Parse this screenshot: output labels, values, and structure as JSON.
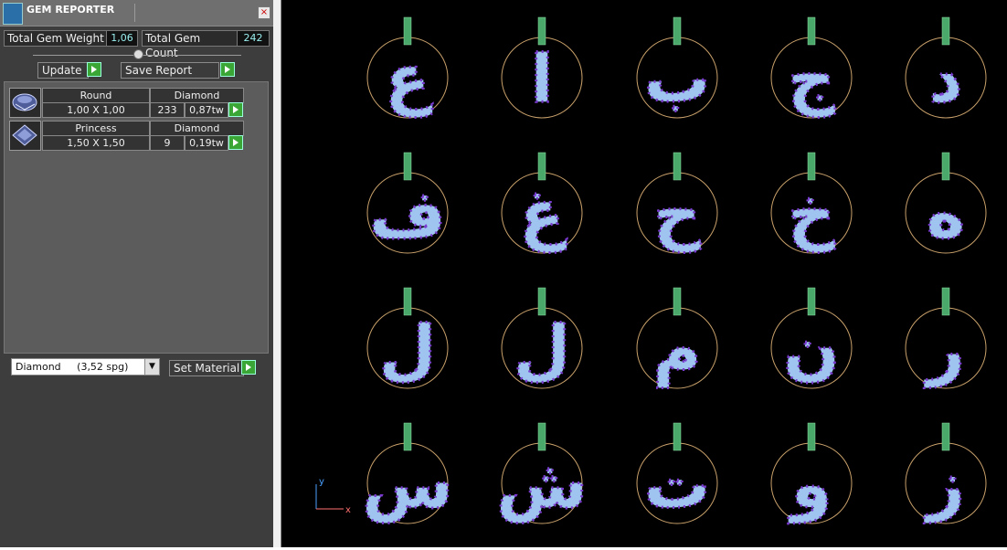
{
  "panel": {
    "title": "GEM REPORTER",
    "close_glyph": "×",
    "total_weight_label": "Total Gem Weight",
    "total_weight_value": "1,06",
    "total_count_label": "Total Gem Count",
    "total_count_value": "242",
    "update_label": "Update",
    "save_report_label": "Save Report",
    "gems": [
      {
        "icon": "round-gem-icon",
        "shape": "Round",
        "material": "Diamond",
        "size": "1,00 X 1,00",
        "count": "233",
        "weight": "0,87tw"
      },
      {
        "icon": "princess-gem-icon",
        "shape": "Princess",
        "material": "Diamond",
        "size": "1,50 X 1,50",
        "count": "9",
        "weight": "0,19tw"
      }
    ],
    "material_select": "Diamond     (3,52 spg)",
    "set_material_label": "Set Material"
  },
  "viewport": {
    "axis_y": "y",
    "axis_x": "x",
    "colors": {
      "background": "#000000",
      "ring": "#c8a06a",
      "beads": "#9fc4ef",
      "bead_dots": "#7a3bd1",
      "bail": "#4aa86a",
      "princess": "#22d046"
    },
    "pendants": [
      {
        "glyph": "ع"
      },
      {
        "glyph": "ا"
      },
      {
        "glyph": "ب"
      },
      {
        "glyph": "ج"
      },
      {
        "glyph": "د"
      },
      {
        "glyph": "ف"
      },
      {
        "glyph": "غ"
      },
      {
        "glyph": "ح"
      },
      {
        "glyph": "خ"
      },
      {
        "glyph": "ه"
      },
      {
        "glyph": "ل"
      },
      {
        "glyph": "ل"
      },
      {
        "glyph": "م"
      },
      {
        "glyph": "ن"
      },
      {
        "glyph": "ر"
      },
      {
        "glyph": "س"
      },
      {
        "glyph": "ش"
      },
      {
        "glyph": "ت"
      },
      {
        "glyph": "و"
      },
      {
        "glyph": "ز"
      }
    ]
  }
}
